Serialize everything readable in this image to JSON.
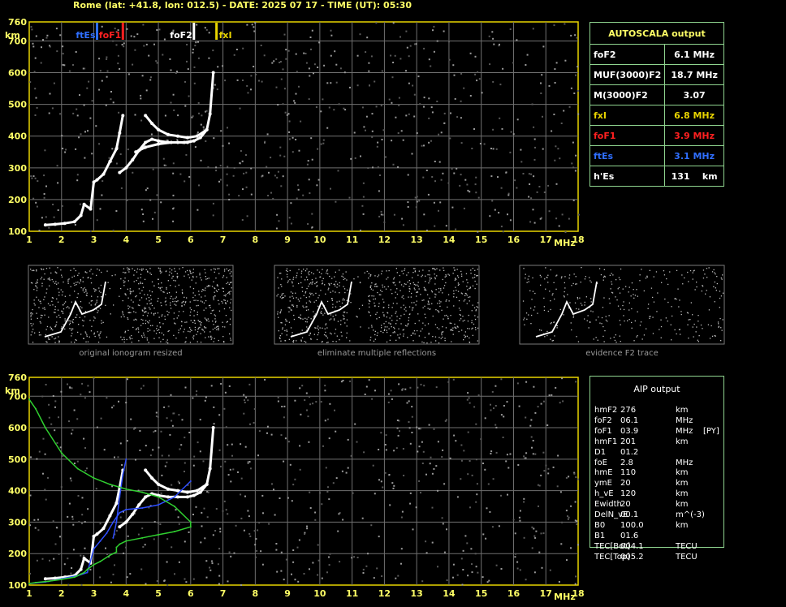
{
  "header": "Rome (lat: +41.8, lon: 012.5) - DATE: 2025 07 17 - TIME (UT): 05:30",
  "autoscala": {
    "title": "AUTOSCALA output",
    "rows": [
      {
        "label": "foF2",
        "value": "6.1 MHz",
        "color": "#ffffff"
      },
      {
        "label": "MUF(3000)F2",
        "value": "18.7 MHz",
        "color": "#ffffff"
      },
      {
        "label": "M(3000)F2",
        "value": "3.07",
        "color": "#ffffff"
      },
      {
        "label": "fxI",
        "value": "6.8 MHz",
        "color": "#e8d400"
      },
      {
        "label": "foF1",
        "value": "3.9 MHz",
        "color": "#ff2020"
      },
      {
        "label": "ftEs",
        "value": "3.1 MHz",
        "color": "#2f6fff"
      },
      {
        "label": "h'Es",
        "value": "131    km",
        "color": "#ffffff"
      }
    ]
  },
  "aip": {
    "title": "AIP output",
    "rows": [
      [
        "hmF2",
        "276",
        "km",
        ""
      ],
      [
        "foF2",
        "06.1",
        "MHz",
        ""
      ],
      [
        "foF1",
        "03.9",
        "MHz",
        "[PY]"
      ],
      [
        "hmF1",
        "201",
        "km",
        ""
      ],
      [
        "D1",
        "01.2",
        "",
        ""
      ],
      [
        "foE",
        "2.8",
        "MHz",
        ""
      ],
      [
        "hmE",
        "110",
        "km",
        ""
      ],
      [
        "ymE",
        "20",
        "km",
        ""
      ],
      [
        "h_vE",
        "120",
        "km",
        ""
      ],
      [
        "Ewidth",
        "20",
        "km",
        ""
      ],
      [
        "DelN_vE",
        "00.1",
        "m^(-3)",
        ""
      ],
      [
        "B0",
        "100.0",
        "km",
        ""
      ],
      [
        "B1",
        "01.6",
        "",
        ""
      ],
      [
        "TEC[Bot]",
        "004.1",
        "TECU",
        ""
      ],
      [
        "TEC[Top]",
        "005.2",
        "TECU",
        ""
      ]
    ]
  },
  "thumb_captions": [
    "original ionogram resized",
    "eliminate multiple reflections",
    "evidence F2 trace"
  ],
  "chart_data": [
    {
      "type": "scatter",
      "title": "",
      "xlabel": "MHz",
      "ylabel": "km",
      "xlim": [
        1,
        18
      ],
      "ylim": [
        100,
        760
      ],
      "xticks": [
        1,
        2,
        3,
        4,
        5,
        6,
        7,
        8,
        9,
        10,
        11,
        12,
        13,
        14,
        15,
        16,
        17,
        18
      ],
      "yticks": [
        100,
        200,
        300,
        400,
        500,
        600,
        700,
        760
      ],
      "grid": true,
      "markers": [
        {
          "name": "ftEs",
          "freq": 3.1,
          "color": "#2f6fff"
        },
        {
          "name": "foF1",
          "freq": 3.9,
          "color": "#ff2020"
        },
        {
          "name": "foF2",
          "freq": 6.1,
          "color": "#ffffff"
        },
        {
          "name": "fxI",
          "freq": 6.8,
          "color": "#e8d400"
        }
      ],
      "series": [
        {
          "color": "#ffffff",
          "x": [
            1.5,
            1.8,
            2.1,
            2.4,
            2.6,
            2.7,
            2.9,
            3.0,
            3.1,
            3.3,
            3.5,
            3.7,
            3.8,
            3.9
          ],
          "y": [
            120,
            122,
            125,
            130,
            150,
            185,
            170,
            255,
            262,
            280,
            320,
            360,
            410,
            465
          ]
        },
        {
          "color": "#ffffff",
          "x": [
            3.8,
            4.0,
            4.2,
            4.4,
            4.6,
            4.8,
            5.0,
            5.3,
            5.6,
            5.9,
            6.1,
            6.3,
            6.5,
            6.6,
            6.7
          ],
          "y": [
            285,
            300,
            325,
            355,
            380,
            390,
            385,
            380,
            380,
            380,
            385,
            395,
            420,
            470,
            600
          ]
        },
        {
          "color": "#ffffff",
          "x": [
            4.3,
            4.6,
            5.0,
            5.4,
            5.8,
            6.1
          ],
          "y": [
            350,
            365,
            375,
            380,
            380,
            385
          ]
        },
        {
          "color": "#ffffff",
          "x": [
            4.6,
            4.8,
            5.0,
            5.3,
            5.6,
            5.9,
            6.2,
            6.5
          ],
          "y": [
            465,
            440,
            420,
            405,
            400,
            395,
            400,
            420
          ]
        }
      ]
    },
    {
      "type": "scatter",
      "title": "",
      "xlabel": "MHz",
      "ylabel": "km",
      "xlim": [
        1,
        18
      ],
      "ylim": [
        100,
        760
      ],
      "xticks": [
        1,
        2,
        3,
        4,
        5,
        6,
        7,
        8,
        9,
        10,
        11,
        12,
        13,
        14,
        15,
        16,
        17,
        18
      ],
      "yticks": [
        100,
        200,
        300,
        400,
        500,
        600,
        700,
        760
      ],
      "grid": true,
      "series": [
        {
          "color": "#ffffff",
          "x": [
            1.5,
            1.8,
            2.1,
            2.4,
            2.6,
            2.7,
            2.9,
            3.0,
            3.1,
            3.3,
            3.5,
            3.7,
            3.8,
            3.9
          ],
          "y": [
            120,
            122,
            125,
            130,
            150,
            185,
            170,
            255,
            262,
            280,
            320,
            360,
            410,
            465
          ]
        },
        {
          "color": "#ffffff",
          "x": [
            3.8,
            4.0,
            4.2,
            4.4,
            4.6,
            4.8,
            5.0,
            5.3,
            5.6,
            5.9,
            6.1,
            6.3,
            6.5,
            6.6,
            6.7
          ],
          "y": [
            285,
            300,
            325,
            355,
            380,
            390,
            385,
            380,
            380,
            380,
            385,
            395,
            420,
            470,
            600
          ]
        },
        {
          "color": "#ffffff",
          "x": [
            4.6,
            4.8,
            5.0,
            5.3,
            5.6,
            5.9,
            6.2,
            6.5
          ],
          "y": [
            465,
            440,
            420,
            405,
            400,
            395,
            400,
            420
          ]
        },
        {
          "color": "#2f4fff",
          "x": [
            1.0,
            1.5,
            2.0,
            2.5,
            2.8,
            3.0,
            3.2,
            3.4,
            3.6,
            3.8,
            4.0,
            4.5,
            5.0,
            5.5,
            6.0
          ],
          "y": [
            105,
            110,
            120,
            130,
            140,
            215,
            240,
            265,
            300,
            330,
            340,
            345,
            355,
            380,
            430
          ]
        },
        {
          "color": "#2f4fff",
          "x": [
            3.6,
            3.7,
            3.8,
            3.9,
            4.0
          ],
          "y": [
            250,
            300,
            380,
            450,
            500
          ]
        },
        {
          "color": "#30d030",
          "x": [
            1.0,
            1.2,
            1.5,
            2.0,
            2.5,
            3.0,
            3.5,
            4.0,
            4.5,
            5.0,
            5.5,
            6.0,
            6.0,
            5.5,
            5.0,
            4.5,
            4.0,
            3.8,
            3.7,
            3.7,
            3.5,
            3.2,
            3.0,
            2.8,
            2.7,
            2.6,
            2.4,
            2.0,
            1.6,
            1.2,
            1.0
          ],
          "y": [
            690,
            660,
            600,
            520,
            470,
            440,
            420,
            405,
            395,
            380,
            350,
            300,
            285,
            270,
            260,
            250,
            240,
            230,
            220,
            205,
            195,
            175,
            165,
            150,
            140,
            135,
            125,
            118,
            112,
            108,
            105
          ]
        }
      ]
    }
  ]
}
